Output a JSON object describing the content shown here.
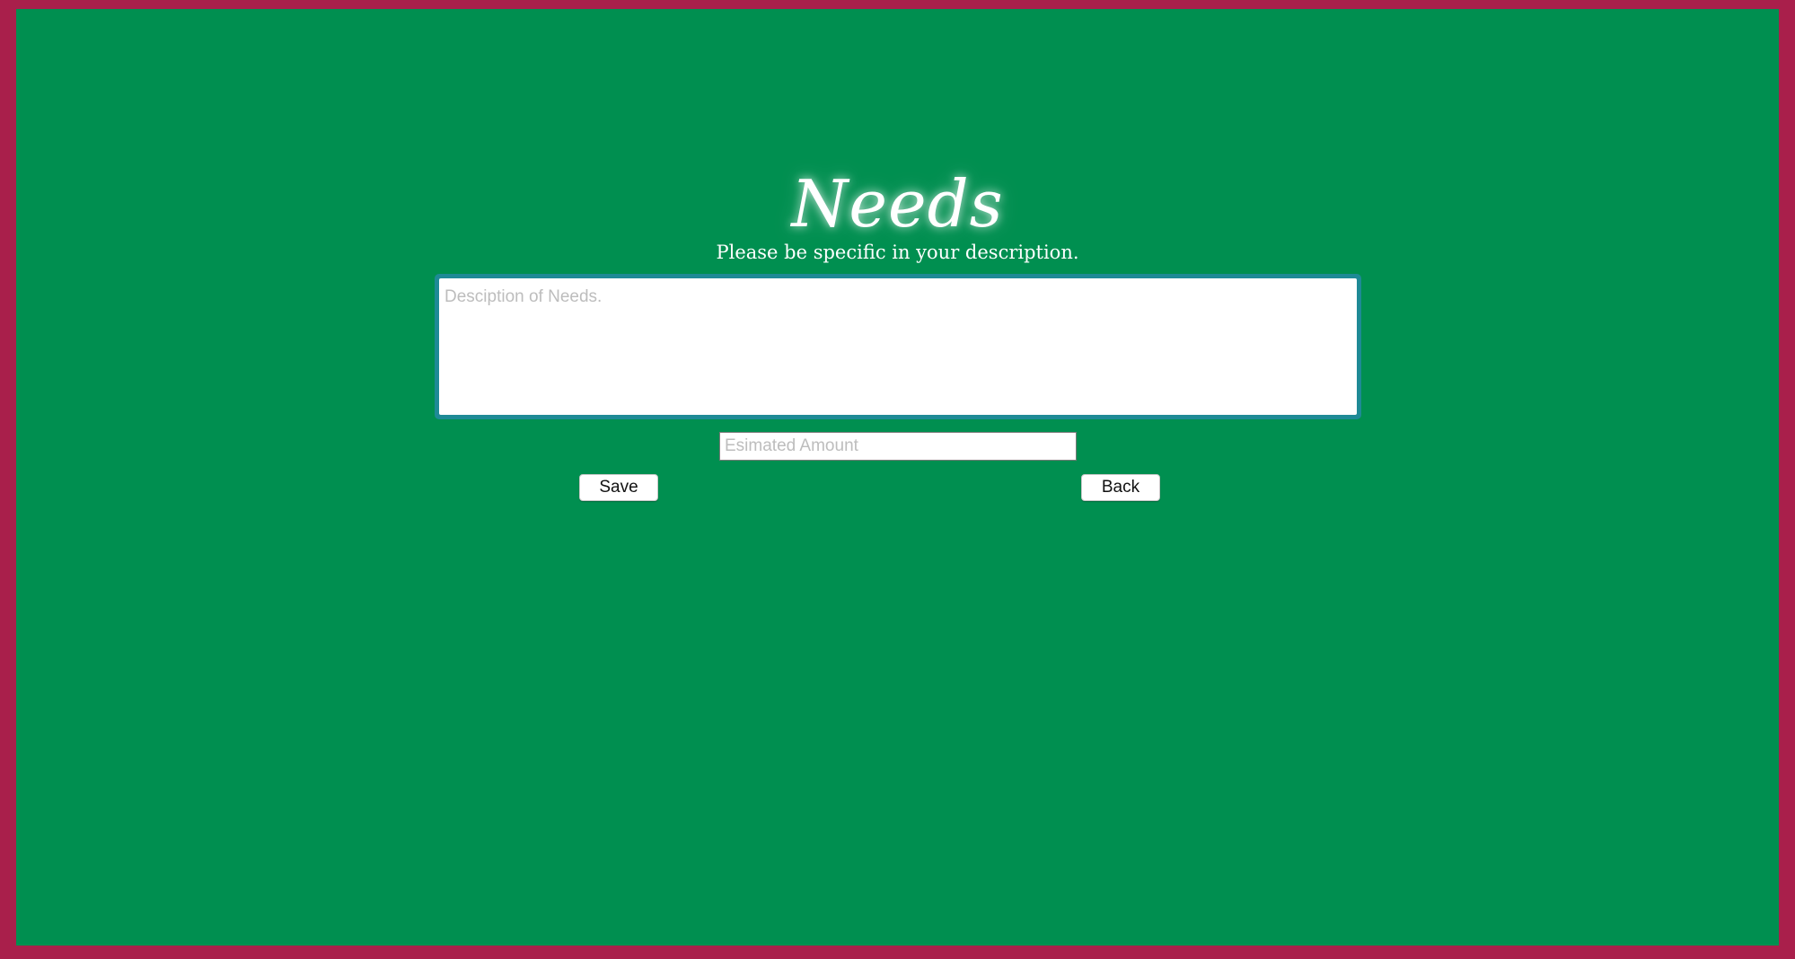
{
  "page": {
    "title": "Needs",
    "subtitle": "Please be specific in your description."
  },
  "form": {
    "description": {
      "value": "",
      "placeholder": "Desciption of Needs."
    },
    "amount": {
      "value": "",
      "placeholder": "Esimated Amount"
    },
    "save_label": "Save",
    "back_label": "Back"
  },
  "colors": {
    "border": "#a91f4b",
    "background": "#008f50",
    "focus_ring": "#1e8a96",
    "text": "#ffffff"
  }
}
